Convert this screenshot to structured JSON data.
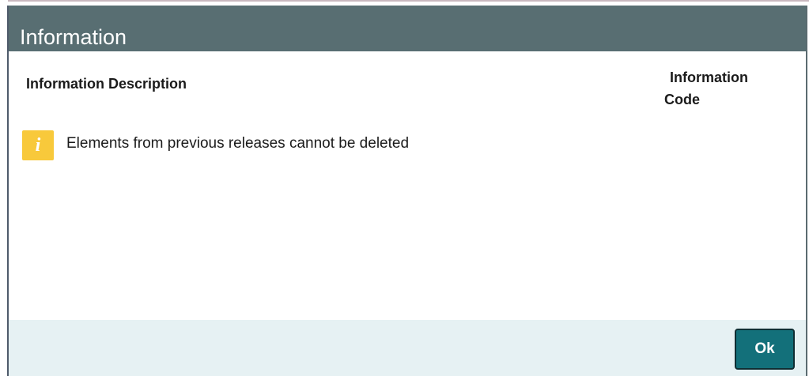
{
  "dialog": {
    "title": "Information"
  },
  "table": {
    "columns": {
      "description": "Information Description",
      "code_line1": "Information",
      "code_line2": "Code"
    },
    "rows": [
      {
        "icon": "info-icon",
        "icon_glyph": "i",
        "description": "Elements from previous releases cannot be deleted",
        "code": ""
      }
    ]
  },
  "footer": {
    "ok_label": "Ok"
  },
  "colors": {
    "title_bar": "#586e72",
    "info_icon": "#f8c93b",
    "ok_button": "#13707a",
    "footer_bg": "#e6f1f3"
  }
}
